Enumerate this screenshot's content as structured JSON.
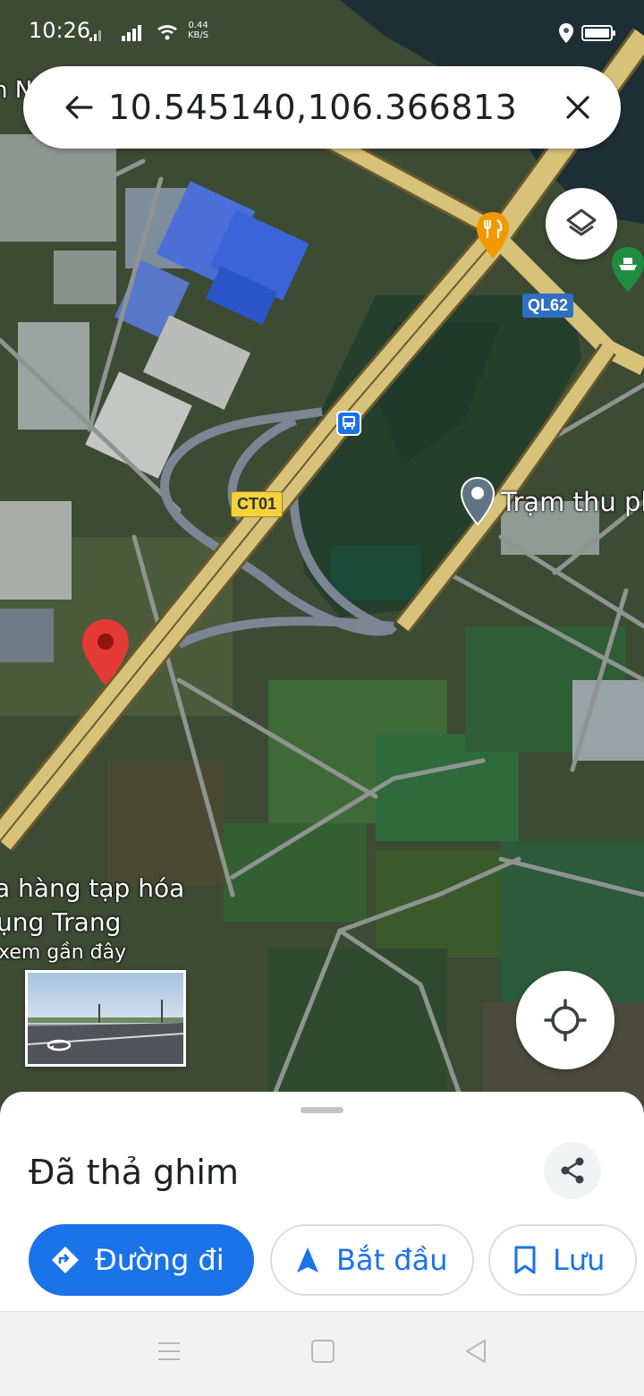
{
  "status_bar": {
    "time": "10:26",
    "net_speed_value": "0.44",
    "net_speed_unit": "KB/S"
  },
  "search": {
    "query": "10.545140,106.366813"
  },
  "map": {
    "road_labels": {
      "ct01": "CT01",
      "ql62": "QL62"
    },
    "places": {
      "toll_station": "Trạm thu ph",
      "shop_line1": "a hàng tạp hóa",
      "shop_line2": "ụng Trang",
      "shop_line3": "xem gần đây"
    },
    "fragment_label": "n N"
  },
  "sheet": {
    "title": "Đã thả ghim",
    "actions": {
      "directions": "Đường đi",
      "start": "Bắt đầu",
      "save": "Lưu"
    }
  },
  "colors": {
    "accent": "#1a73e8",
    "pin": "#e53935",
    "highway": "#d8c27a"
  }
}
